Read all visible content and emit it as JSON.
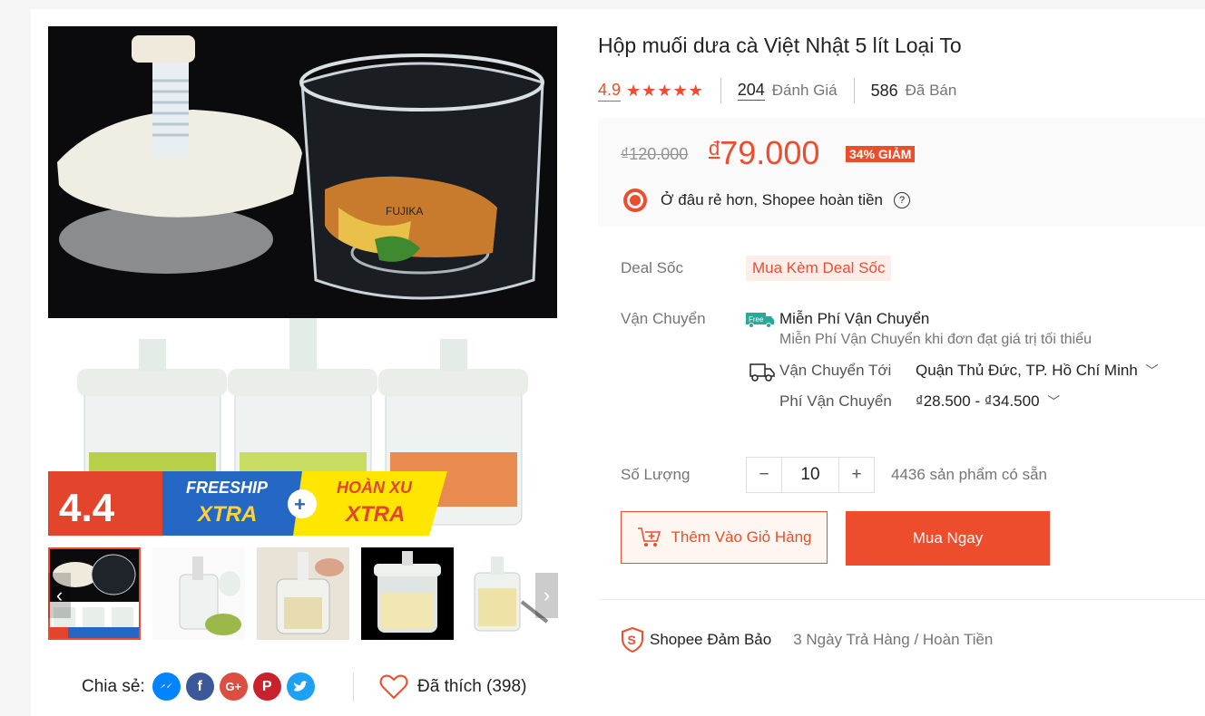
{
  "product": {
    "title": "Hộp muối dưa cà Việt Nhật 5 lít Loại To",
    "rating": "4.9",
    "stars": "★★★★★",
    "reviews_count": "204",
    "reviews_label": "Đánh Giá",
    "sold_count": "586",
    "sold_label": "Đã Bán",
    "old_price": "₫120.000",
    "price_currency": "đ",
    "price": "79.000",
    "discount": "34% GIẢM",
    "guarantee_text": "Ở đâu rẻ hơn, Shopee hoàn tiền"
  },
  "deal": {
    "label": "Deal Sốc",
    "tag": "Mua Kèm Deal Sốc"
  },
  "shipping": {
    "label": "Vận Chuyển",
    "free_title": "Miễn Phí Vận Chuyển",
    "free_desc": "Miễn Phí Vận Chuyển khi đơn đạt giá trị tối thiểu",
    "free_badge": "Free",
    "to_label": "Vận Chuyển Tới",
    "to_value": "Quận Thủ Đức, TP. Hồ Chí Minh",
    "fee_label": "Phí Vận Chuyển",
    "fee_value": "₫28.500 - ₫34.500"
  },
  "quantity": {
    "label": "Số Lượng",
    "value": "10",
    "minus": "−",
    "plus": "+",
    "stock": "4436 sản phẩm có sẵn"
  },
  "buttons": {
    "add_to_cart": "Thêm Vào Giỏ Hàng",
    "buy_now": "Mua Ngay"
  },
  "assurance": {
    "title": "Shopee Đảm Bảo",
    "desc": "3 Ngày Trả Hàng / Hoàn Tiền"
  },
  "share": {
    "label": "Chia sẻ:"
  },
  "like": {
    "label": "Đã thích (398)"
  },
  "banner": {
    "sale": "4.4",
    "freeship": "FREESHIP",
    "xtra": "XTRA",
    "hoanxu": "HOÀN XU",
    "plus": "+"
  },
  "brand_label": "FUJIKA",
  "icons": [
    "messenger-icon",
    "facebook-icon",
    "google-plus-icon",
    "pinterest-icon",
    "twitter-icon",
    "heart-icon",
    "cart-plus-icon",
    "truck-icon",
    "shield-icon",
    "question-icon",
    "chevron-down-icon",
    "chevron-left-icon",
    "chevron-right-icon"
  ],
  "colors": {
    "accent": "#ee4d2d",
    "free_green": "#26aa99"
  }
}
